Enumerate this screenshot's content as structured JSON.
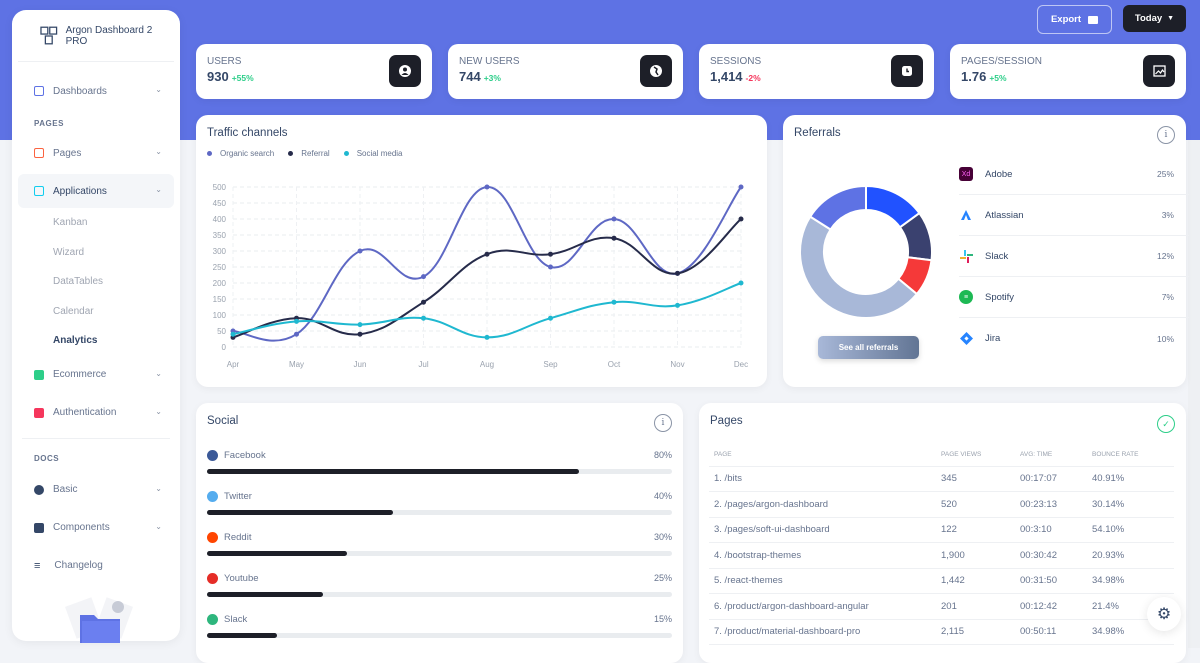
{
  "app": {
    "title": "Argon Dashboard 2 PRO"
  },
  "sidebar": {
    "items": [
      {
        "label": "Dashboards",
        "icon": "shop-icon",
        "color": "#5e72e4"
      },
      {
        "section": "PAGES"
      },
      {
        "label": "Pages",
        "icon": "ungroup-icon",
        "color": "#fb6340"
      },
      {
        "label": "Applications",
        "icon": "apps-icon",
        "color": "#11cdef"
      }
    ],
    "sub_items": [
      "Kanban",
      "Wizard",
      "DataTables",
      "Calendar",
      "Analytics"
    ],
    "items2": [
      {
        "label": "Ecommerce",
        "icon": "basket-icon",
        "color": "#2dce89"
      },
      {
        "label": "Authentication",
        "icon": "badge-icon",
        "color": "#f5365c"
      }
    ],
    "docs_section": "DOCS",
    "docs": [
      {
        "label": "Basic",
        "icon": "spaceship-icon"
      },
      {
        "label": "Components",
        "icon": "box-icon"
      },
      {
        "label": "Changelog",
        "icon": "list-icon"
      }
    ]
  },
  "header": {
    "export_label": "Export",
    "today_label": "Today"
  },
  "stats": [
    {
      "label": "USERS",
      "value": "930",
      "change": "+55%",
      "positive": true,
      "icon": "user-icon"
    },
    {
      "label": "NEW USERS",
      "value": "744",
      "change": "+3%",
      "positive": true,
      "icon": "globe-icon"
    },
    {
      "label": "SESSIONS",
      "value": "1,414",
      "change": "-2%",
      "positive": false,
      "icon": "clock-icon"
    },
    {
      "label": "PAGES/SESSION",
      "value": "1.76",
      "change": "+5%",
      "positive": true,
      "icon": "image-icon"
    }
  ],
  "traffic": {
    "title": "Traffic channels"
  },
  "chart_data": {
    "type": "line",
    "title": "Traffic channels",
    "categories": [
      "Apr",
      "May",
      "Jun",
      "Jul",
      "Aug",
      "Sep",
      "Oct",
      "Nov",
      "Dec"
    ],
    "series": [
      {
        "name": "Organic search",
        "color": "#5e68c4",
        "values": [
          50,
          40,
          300,
          220,
          500,
          250,
          400,
          230,
          500
        ]
      },
      {
        "name": "Referral",
        "color": "#262b4a",
        "values": [
          30,
          90,
          40,
          140,
          290,
          290,
          340,
          230,
          400
        ]
      },
      {
        "name": "Social media",
        "color": "#1fb8d0",
        "values": [
          40,
          80,
          70,
          90,
          30,
          90,
          140,
          130,
          200
        ]
      }
    ],
    "yticks": [
      0,
      50,
      100,
      150,
      200,
      250,
      300,
      350,
      400,
      450,
      500
    ],
    "ylim": [
      0,
      500
    ],
    "grid": true,
    "legend": "top-left"
  },
  "referrals": {
    "title": "Referrals",
    "button": "See all referrals",
    "donut": [
      {
        "value": 15,
        "color": "#2152ff"
      },
      {
        "value": 12,
        "color": "#3a416f"
      },
      {
        "value": 9,
        "color": "#f53939"
      },
      {
        "value": 48,
        "color": "#a8b8d8"
      },
      {
        "value": 16,
        "color": "#5e72e4"
      }
    ],
    "items": [
      {
        "name": "Adobe",
        "pct": "25%",
        "icon": "adobe-xd-icon"
      },
      {
        "name": "Atlassian",
        "pct": "3%",
        "icon": "atlassian-icon"
      },
      {
        "name": "Slack",
        "pct": "12%",
        "icon": "slack-icon"
      },
      {
        "name": "Spotify",
        "pct": "7%",
        "icon": "spotify-icon"
      },
      {
        "name": "Jira",
        "pct": "10%",
        "icon": "jira-icon"
      }
    ]
  },
  "social": {
    "title": "Social",
    "items": [
      {
        "name": "Facebook",
        "pct": "80%",
        "value": 80,
        "color": "#3b5998"
      },
      {
        "name": "Twitter",
        "pct": "40%",
        "value": 40,
        "color": "#55acee"
      },
      {
        "name": "Reddit",
        "pct": "30%",
        "value": 30,
        "color": "#ff4500"
      },
      {
        "name": "Youtube",
        "pct": "25%",
        "value": 25,
        "color": "#e52d27"
      },
      {
        "name": "Slack",
        "pct": "15%",
        "value": 15,
        "color": "#2eb67d"
      }
    ]
  },
  "pages": {
    "title": "Pages",
    "columns": [
      "PAGE",
      "PAGE VIEWS",
      "AVG: TIME",
      "BOUNCE RATE"
    ],
    "rows": [
      [
        "1. /bits",
        "345",
        "00:17:07",
        "40.91%"
      ],
      [
        "2. /pages/argon-dashboard",
        "520",
        "00:23:13",
        "30.14%"
      ],
      [
        "3. /pages/soft-ui-dashboard",
        "122",
        "00:3:10",
        "54.10%"
      ],
      [
        "4. /bootstrap-themes",
        "1,900",
        "00:30:42",
        "20.93%"
      ],
      [
        "5. /react-themes",
        "1,442",
        "00:31:50",
        "34.98%"
      ],
      [
        "6. /product/argon-dashboard-angular",
        "201",
        "00:12:42",
        "21.4%"
      ],
      [
        "7. /product/material-dashboard-pro",
        "2,115",
        "00:50:11",
        "34.98%"
      ]
    ]
  }
}
